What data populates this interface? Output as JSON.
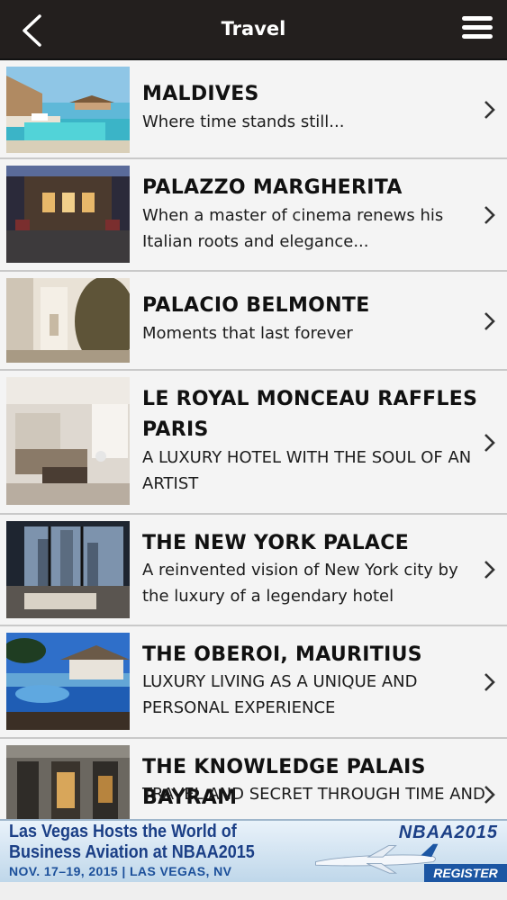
{
  "header": {
    "title": "Travel",
    "back_icon": "chevron-left-icon",
    "menu_icon": "hamburger-menu-icon"
  },
  "items": [
    {
      "title": "MALDIVES",
      "subtitle": "Where time stands still...",
      "image": "maldives-overwater-villas"
    },
    {
      "title": "PALAZZO MARGHERITA",
      "subtitle": "When a master of cinema renews his Italian roots and elegance...",
      "image": "palazzo-courtyard-night"
    },
    {
      "title": "PALACIO BELMONTE",
      "subtitle": "Moments that last forever",
      "image": "palacio-stone-wall"
    },
    {
      "title": "LE ROYAL MONCEAU RAFFLES PARIS",
      "subtitle": "A LUXURY HOTEL WITH THE SOUL OF AN ARTIST",
      "image": "hotel-suite-living-room"
    },
    {
      "title": "THE NEW YORK PALACE",
      "subtitle": "A reinvented vision of New York city by the luxury of a legendary hotel",
      "image": "ny-suite-window-view"
    },
    {
      "title": "THE OBEROI, MAURITIUS",
      "subtitle": "LUXURY LIVING AS A UNIQUE AND PERSONAL EXPERIENCE",
      "image": "mauritius-pool-villa"
    },
    {
      "title": "THE KNOWLEDGE PALAIS BAYRAM",
      "subtitle": "TRAVEL AND SECRET THROUGH TIME AND",
      "image": "palais-facade"
    }
  ],
  "banner": {
    "line1": "Las Vegas Hosts the World of",
    "line2": "Business Aviation at NBAA2015",
    "date": "NOV. 17–19, 2015 | LAS VEGAS, NV",
    "logo": "NBAA2015",
    "register": "REGISTER"
  }
}
